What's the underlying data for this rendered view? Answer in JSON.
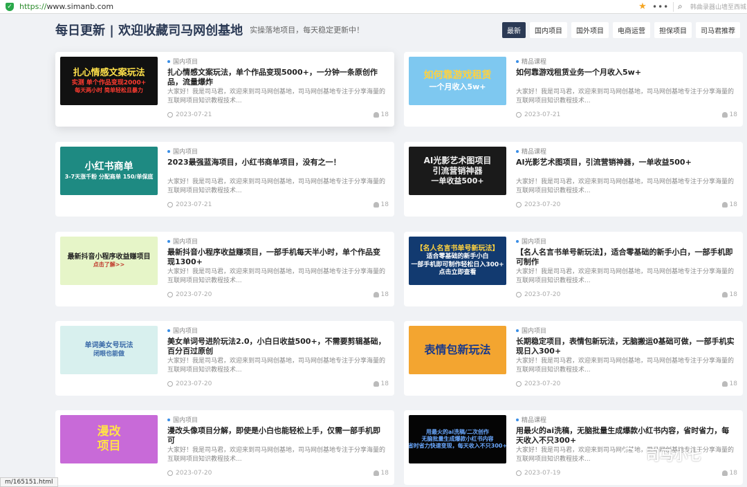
{
  "browser": {
    "url_scheme": "https://",
    "url_host": "www.simanb.com",
    "search_text": "韩曲录器山墙至西城",
    "status_url": "m/165151.html"
  },
  "header": {
    "title": "每日更新 | 欢迎收藏司马网创基地",
    "subtitle": "实操落地项目，每天稳定更新中！",
    "tabs": [
      "最新",
      "国内项目",
      "国外项目",
      "电商运营",
      "担保项目",
      "司马君推荐"
    ]
  },
  "excerpt": "大家好！我是司马君，欢迎来到司马网创基地，司马网创基地专注于分享海量的互联网项目知识教程技术...",
  "cards": [
    {
      "category": "国内项目",
      "title": "扎心情感文案玩法，单个作品变现5000+，一分钟一条原创作品，流量爆炸",
      "date": "2023-07-21",
      "views": "18",
      "thumb": {
        "bg": "#111111",
        "lines": [
          "扎心情感文案玩法",
          "实测 单个作品变现2000+",
          "每天两小时 简单轻松且暴力"
        ],
        "colors": [
          "#ffe14a",
          "#ff3b30",
          "#ff3b30"
        ],
        "sizes": [
          13,
          9,
          8
        ]
      }
    },
    {
      "category": "精品课程",
      "title": "如何靠游戏租赁业务一个月收入5w+",
      "date": "2023-07-21",
      "views": "18",
      "thumb": {
        "bg": "#7ec8f0",
        "lines": [
          "如何靠游戏租赁",
          "一个月收入5w+"
        ],
        "colors": [
          "#ffd23f",
          "#ffffff"
        ],
        "sizes": [
          14,
          11
        ]
      }
    },
    {
      "category": "国内项目",
      "title": "2023最强蓝海项目，小红书商单项目，没有之一！",
      "date": "2023-07-21",
      "views": "18",
      "thumb": {
        "bg": "#1e8a82",
        "lines": [
          "小红书商单",
          "3-7天涨千粉 分配商单 150/单保底"
        ],
        "colors": [
          "#ffffff",
          "#ffffff"
        ],
        "sizes": [
          14,
          8
        ]
      }
    },
    {
      "category": "精品课程",
      "title": "AI光影艺术图项目，引流营销神器，一单收益500+",
      "date": "2023-07-20",
      "views": "18",
      "thumb": {
        "bg": "#1a1a1a",
        "lines": [
          "AI光影艺术图项目",
          "引流营销神器",
          "一单收益500+"
        ],
        "colors": [
          "#eeeeee",
          "#eeeeee",
          "#eeeeee"
        ],
        "sizes": [
          12,
          12,
          11
        ]
      }
    },
    {
      "category": "国内项目",
      "title": "最新抖音小程序收益赚项目，一部手机每天半小时，单个作品变现1300+",
      "date": "2023-07-20",
      "views": "18",
      "thumb": {
        "bg": "#e6f5c8",
        "lines": [
          "最新抖音小程序收益赚项目",
          "点击了解>>"
        ],
        "colors": [
          "#222222",
          "#c0392b"
        ],
        "sizes": [
          10,
          8
        ]
      }
    },
    {
      "category": "国内项目",
      "title": "【名人名言书单号新玩法】，适合零基础的新手小白，一部手机即可制作",
      "date": "2023-07-20",
      "views": "18",
      "thumb": {
        "bg": "#123a70",
        "lines": [
          "【名人名言书单号新玩法】",
          "适合零基础的新手小白",
          "一部手机即可制作轻松日入300+",
          "点击立即查看"
        ],
        "colors": [
          "#ffd23f",
          "#ffffff",
          "#ffffff",
          "#ffffff"
        ],
        "sizes": [
          10,
          9,
          9,
          9
        ]
      }
    },
    {
      "category": "国内项目",
      "title": "美女单词号进阶玩法2.0，小白日收益500+，不需要剪辑基础，百分百过原创",
      "date": "2023-07-20",
      "views": "18",
      "thumb": {
        "bg": "#d8f0ee",
        "lines": [
          "单词美女号玩法",
          "闭眼也能做"
        ],
        "colors": [
          "#3a6aa8",
          "#3a6aa8"
        ],
        "sizes": [
          10,
          9
        ]
      }
    },
    {
      "category": "国内项目",
      "title": "长期稳定项目，表情包新玩法，无脑搬运0基础可做，一部手机实现日入300+",
      "date": "2023-07-20",
      "views": "18",
      "thumb": {
        "bg": "#f3a530",
        "lines": [
          "表情包新玩法"
        ],
        "colors": [
          "#1a3a8a"
        ],
        "sizes": [
          16
        ]
      }
    },
    {
      "category": "国内项目",
      "title": "漫改头像项目分解，即使是小白也能轻松上手，仅需一部手机即可",
      "date": "2023-07-20",
      "views": "18",
      "thumb": {
        "bg": "#c86ad8",
        "lines": [
          "漫改",
          "项目"
        ],
        "colors": [
          "#ffe14a",
          "#ffe14a"
        ],
        "sizes": [
          17,
          17
        ]
      }
    },
    {
      "category": "精品课程",
      "title": "用最火的ai洗稿，无脑批量生成爆款小红书内容，省时省力，每天收入不只300+",
      "date": "2023-07-19",
      "views": "18",
      "thumb": {
        "bg": "#050505",
        "lines": [
          "用最火的ai洗稿/二次创作",
          "无脑批量生成爆款小红书内容",
          "省时省力快速变现，每天收入不只300+"
        ],
        "colors": [
          "#6aa8ff",
          "#6aa8ff",
          "#6aa8ff"
        ],
        "sizes": [
          8,
          8,
          8
        ]
      }
    }
  ],
  "watermark": "司马小七"
}
